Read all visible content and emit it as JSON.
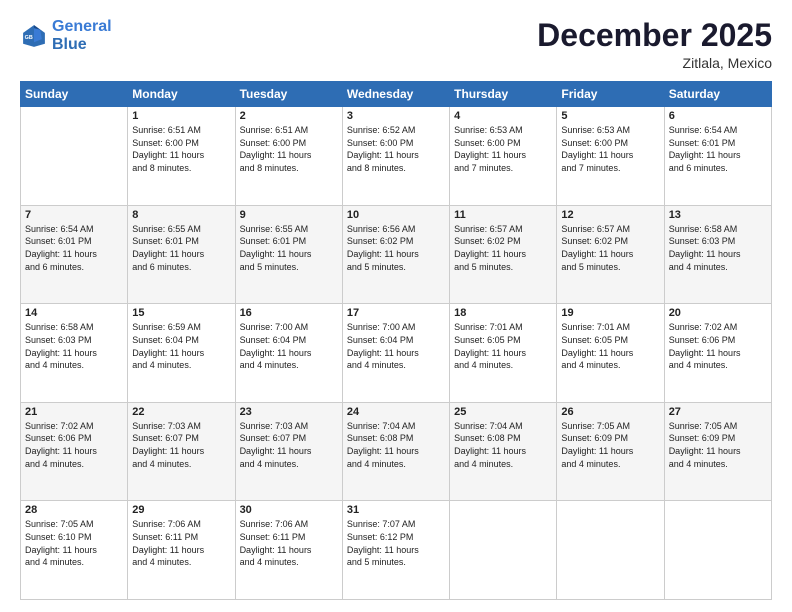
{
  "header": {
    "logo": {
      "line1": "General",
      "line2": "Blue"
    },
    "title": "December 2025",
    "subtitle": "Zitlala, Mexico"
  },
  "weekdays": [
    "Sunday",
    "Monday",
    "Tuesday",
    "Wednesday",
    "Thursday",
    "Friday",
    "Saturday"
  ],
  "weeks": [
    [
      {
        "day": "",
        "info": ""
      },
      {
        "day": "1",
        "info": "Sunrise: 6:51 AM\nSunset: 6:00 PM\nDaylight: 11 hours\nand 8 minutes."
      },
      {
        "day": "2",
        "info": "Sunrise: 6:51 AM\nSunset: 6:00 PM\nDaylight: 11 hours\nand 8 minutes."
      },
      {
        "day": "3",
        "info": "Sunrise: 6:52 AM\nSunset: 6:00 PM\nDaylight: 11 hours\nand 8 minutes."
      },
      {
        "day": "4",
        "info": "Sunrise: 6:53 AM\nSunset: 6:00 PM\nDaylight: 11 hours\nand 7 minutes."
      },
      {
        "day": "5",
        "info": "Sunrise: 6:53 AM\nSunset: 6:00 PM\nDaylight: 11 hours\nand 7 minutes."
      },
      {
        "day": "6",
        "info": "Sunrise: 6:54 AM\nSunset: 6:01 PM\nDaylight: 11 hours\nand 6 minutes."
      }
    ],
    [
      {
        "day": "7",
        "info": "Sunrise: 6:54 AM\nSunset: 6:01 PM\nDaylight: 11 hours\nand 6 minutes."
      },
      {
        "day": "8",
        "info": "Sunrise: 6:55 AM\nSunset: 6:01 PM\nDaylight: 11 hours\nand 6 minutes."
      },
      {
        "day": "9",
        "info": "Sunrise: 6:55 AM\nSunset: 6:01 PM\nDaylight: 11 hours\nand 5 minutes."
      },
      {
        "day": "10",
        "info": "Sunrise: 6:56 AM\nSunset: 6:02 PM\nDaylight: 11 hours\nand 5 minutes."
      },
      {
        "day": "11",
        "info": "Sunrise: 6:57 AM\nSunset: 6:02 PM\nDaylight: 11 hours\nand 5 minutes."
      },
      {
        "day": "12",
        "info": "Sunrise: 6:57 AM\nSunset: 6:02 PM\nDaylight: 11 hours\nand 5 minutes."
      },
      {
        "day": "13",
        "info": "Sunrise: 6:58 AM\nSunset: 6:03 PM\nDaylight: 11 hours\nand 4 minutes."
      }
    ],
    [
      {
        "day": "14",
        "info": "Sunrise: 6:58 AM\nSunset: 6:03 PM\nDaylight: 11 hours\nand 4 minutes."
      },
      {
        "day": "15",
        "info": "Sunrise: 6:59 AM\nSunset: 6:04 PM\nDaylight: 11 hours\nand 4 minutes."
      },
      {
        "day": "16",
        "info": "Sunrise: 7:00 AM\nSunset: 6:04 PM\nDaylight: 11 hours\nand 4 minutes."
      },
      {
        "day": "17",
        "info": "Sunrise: 7:00 AM\nSunset: 6:04 PM\nDaylight: 11 hours\nand 4 minutes."
      },
      {
        "day": "18",
        "info": "Sunrise: 7:01 AM\nSunset: 6:05 PM\nDaylight: 11 hours\nand 4 minutes."
      },
      {
        "day": "19",
        "info": "Sunrise: 7:01 AM\nSunset: 6:05 PM\nDaylight: 11 hours\nand 4 minutes."
      },
      {
        "day": "20",
        "info": "Sunrise: 7:02 AM\nSunset: 6:06 PM\nDaylight: 11 hours\nand 4 minutes."
      }
    ],
    [
      {
        "day": "21",
        "info": "Sunrise: 7:02 AM\nSunset: 6:06 PM\nDaylight: 11 hours\nand 4 minutes."
      },
      {
        "day": "22",
        "info": "Sunrise: 7:03 AM\nSunset: 6:07 PM\nDaylight: 11 hours\nand 4 minutes."
      },
      {
        "day": "23",
        "info": "Sunrise: 7:03 AM\nSunset: 6:07 PM\nDaylight: 11 hours\nand 4 minutes."
      },
      {
        "day": "24",
        "info": "Sunrise: 7:04 AM\nSunset: 6:08 PM\nDaylight: 11 hours\nand 4 minutes."
      },
      {
        "day": "25",
        "info": "Sunrise: 7:04 AM\nSunset: 6:08 PM\nDaylight: 11 hours\nand 4 minutes."
      },
      {
        "day": "26",
        "info": "Sunrise: 7:05 AM\nSunset: 6:09 PM\nDaylight: 11 hours\nand 4 minutes."
      },
      {
        "day": "27",
        "info": "Sunrise: 7:05 AM\nSunset: 6:09 PM\nDaylight: 11 hours\nand 4 minutes."
      }
    ],
    [
      {
        "day": "28",
        "info": "Sunrise: 7:05 AM\nSunset: 6:10 PM\nDaylight: 11 hours\nand 4 minutes."
      },
      {
        "day": "29",
        "info": "Sunrise: 7:06 AM\nSunset: 6:11 PM\nDaylight: 11 hours\nand 4 minutes."
      },
      {
        "day": "30",
        "info": "Sunrise: 7:06 AM\nSunset: 6:11 PM\nDaylight: 11 hours\nand 4 minutes."
      },
      {
        "day": "31",
        "info": "Sunrise: 7:07 AM\nSunset: 6:12 PM\nDaylight: 11 hours\nand 5 minutes."
      },
      {
        "day": "",
        "info": ""
      },
      {
        "day": "",
        "info": ""
      },
      {
        "day": "",
        "info": ""
      }
    ]
  ]
}
